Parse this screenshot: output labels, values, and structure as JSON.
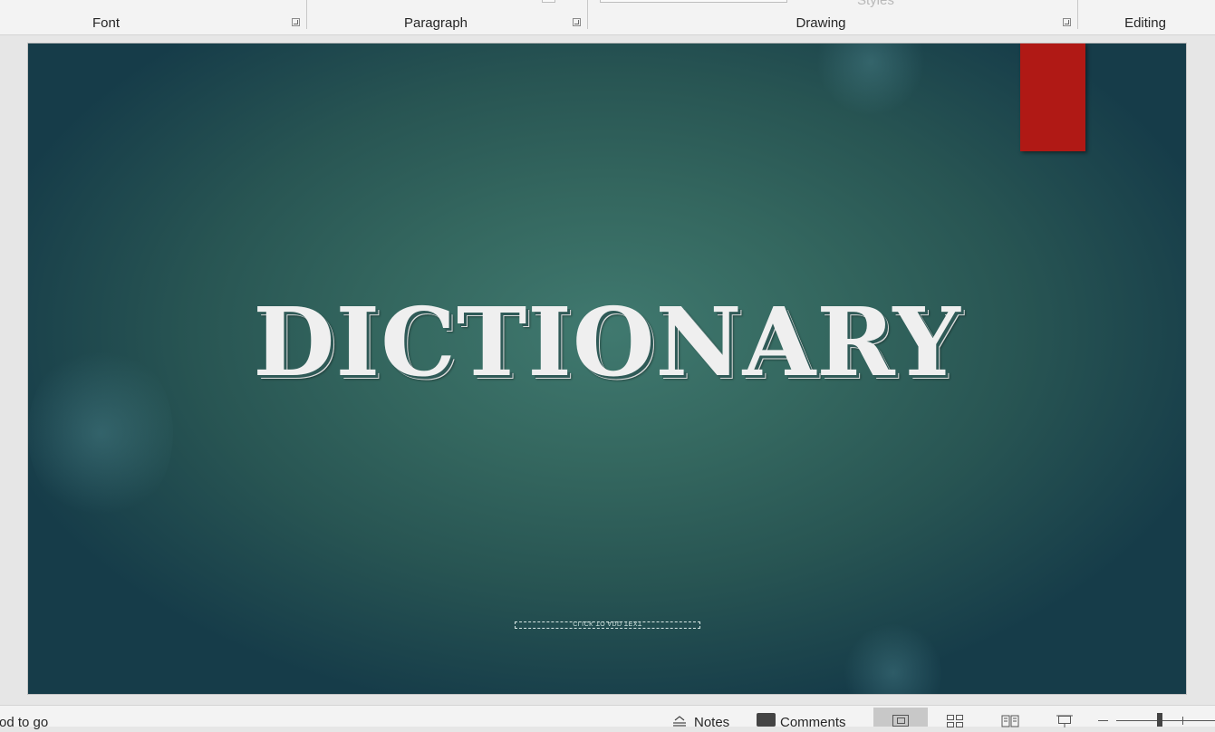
{
  "ribbon": {
    "groups": {
      "font": "Font",
      "paragraph": "Paragraph",
      "drawing": "Drawing",
      "editing": "Editing"
    },
    "cut_styles_label": "Styles"
  },
  "slide": {
    "title": "DICTIONARY",
    "subtitle_placeholder": "CLICK TO ADD TEXT",
    "accent_color": "#b01915",
    "background_color": "#2f6660"
  },
  "statusbar": {
    "status_text": "od to go",
    "notes_label": "Notes",
    "comments_label": "Comments",
    "views": [
      "normal-view-icon",
      "slide-sorter-icon",
      "reading-view-icon",
      "slide-show-icon"
    ],
    "active_view": "normal"
  }
}
